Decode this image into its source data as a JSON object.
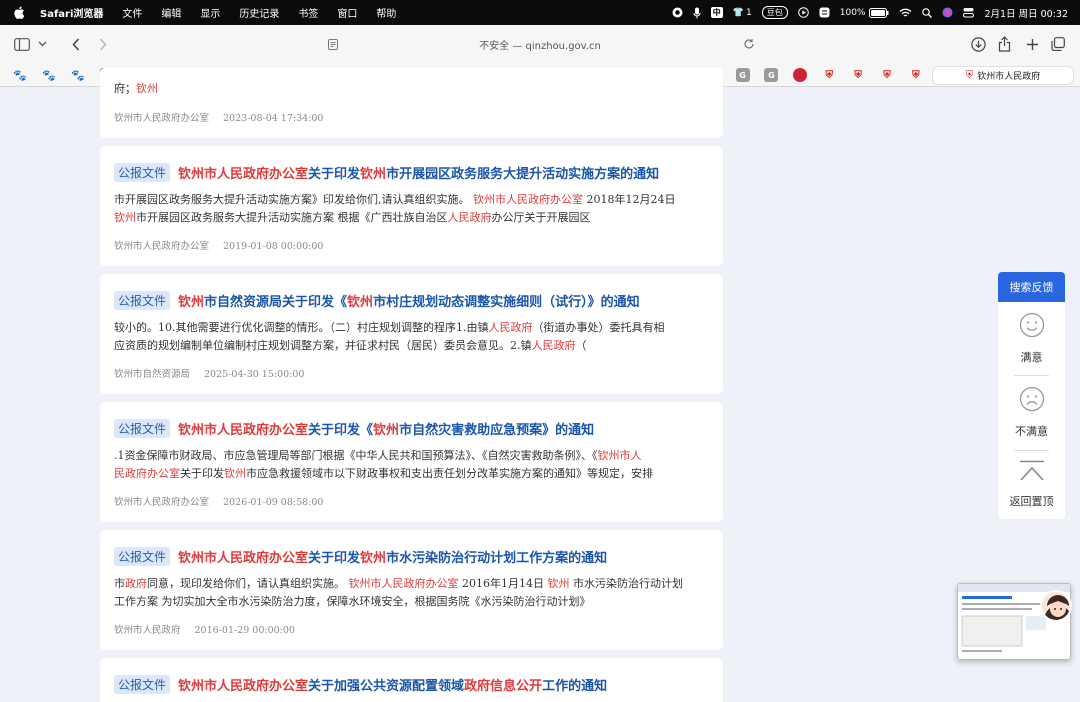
{
  "menubar": {
    "app": "Safari浏览器",
    "items": [
      "文件",
      "编辑",
      "显示",
      "历史记录",
      "书签",
      "窗口",
      "帮助"
    ],
    "tray": {
      "badge_count": "1",
      "douban": "豆包",
      "battery": "100%",
      "datetime": "2月1日 周日  00:32"
    }
  },
  "toolbar": {
    "address": "不安全 — qinzhou.gov.cn"
  },
  "favorites": {
    "icons": [
      "paw",
      "paw",
      "paw",
      "N",
      "N",
      "gov",
      "gov",
      "H",
      "H",
      "paw",
      "star",
      "paw",
      "H",
      "gov",
      "gov",
      "gov",
      "paw",
      "N",
      "gov",
      "gov",
      "star",
      "star",
      "S",
      "gov",
      "G",
      "G",
      "G",
      "round",
      "gov",
      "gov",
      "gov",
      "gov"
    ],
    "active_tab": "钦州市人民政府"
  },
  "results": [
    {
      "desc": [
        [
          [
            "府；",
            ""
          ],
          [
            "钦州",
            "red"
          ]
        ]
      ],
      "meta": [
        "钦州市人民政府办公室",
        "2023-08-04 17:34:00"
      ]
    },
    {
      "tag": "公报文件",
      "title": [
        [
          "钦州市人民政府办公室",
          "red"
        ],
        [
          "关于印发",
          ""
        ],
        [
          "钦州",
          "red"
        ],
        [
          "市开展园区政务服务大提升活动实施方案的通知",
          ""
        ]
      ],
      "desc": [
        [
          [
            "市开展园区政务服务大提升活动实施方案》印发给你们,请认真组织实施。 ",
            ""
          ],
          [
            "钦州市人民政府办公室",
            "red"
          ],
          [
            " 2018年12月24日",
            ""
          ]
        ],
        [
          [
            "钦州",
            "red"
          ],
          [
            "市开展园区政务服务大提升活动实施方案 根据《广西壮族自治区",
            ""
          ],
          [
            "人民政府",
            "red"
          ],
          [
            "办公厅关于开展园区",
            ""
          ]
        ]
      ],
      "meta": [
        "钦州市人民政府办公室",
        "2019-01-08 00:00:00"
      ]
    },
    {
      "tag": "公报文件",
      "title": [
        [
          "钦州",
          "red"
        ],
        [
          "市自然资源局关于印发《",
          ""
        ],
        [
          "钦州",
          "red"
        ],
        [
          "市村庄规划动态调整实施细则（试行）》的通知",
          ""
        ]
      ],
      "desc": [
        [
          [
            "较小的。10.其他需要进行优化调整的情形。（二）村庄规划调整的程序1.由镇",
            ""
          ],
          [
            "人民政府",
            "red"
          ],
          [
            "（街道办事处）委托具有相",
            ""
          ]
        ],
        [
          [
            "应资质的规划编制单位编制村庄规划调整方案，并征求村民（居民）委员会意见。2.镇",
            ""
          ],
          [
            "人民政府",
            "red"
          ],
          [
            "（",
            ""
          ]
        ]
      ],
      "meta": [
        "钦州市自然资源局",
        "2025-04-30 15:00:00"
      ]
    },
    {
      "tag": "公报文件",
      "title": [
        [
          "钦州市人民政府办公室",
          "red"
        ],
        [
          "关于印发《",
          ""
        ],
        [
          "钦州",
          "red"
        ],
        [
          "市自然灾害救助应急预案》的通知",
          ""
        ]
      ],
      "desc": [
        [
          [
            ".1资金保障市财政局、市应急管理局等部门根据《中华人民共和国预算法》、《自然灾害救助条例》、《",
            ""
          ],
          [
            "钦州市人",
            "red"
          ]
        ],
        [
          [
            "民政府办公室",
            "red"
          ],
          [
            "关于印发",
            ""
          ],
          [
            "钦州",
            "red"
          ],
          [
            "市应急救援领域市以下财政事权和支出责任划分改革实施方案的通知》等规定，安排",
            ""
          ]
        ]
      ],
      "meta": [
        "钦州市人民政府办公室",
        "2026-01-09 08:58:00"
      ]
    },
    {
      "tag": "公报文件",
      "title": [
        [
          "钦州市人民政府办公室",
          "red"
        ],
        [
          "关于印发",
          ""
        ],
        [
          "钦州",
          "red"
        ],
        [
          "市水污染防治行动计划工作方案的通知",
          ""
        ]
      ],
      "desc": [
        [
          [
            "市",
            ""
          ],
          [
            "政府",
            "red"
          ],
          [
            "同意，现印发给你们，请认真组织实施。 ",
            ""
          ],
          [
            "钦州市人民政府办公室",
            "red"
          ],
          [
            " 2016年1月14日 ",
            ""
          ],
          [
            "钦州",
            "red"
          ],
          [
            " 市水污染防治行动计划",
            ""
          ]
        ],
        [
          [
            "工作方案        为切实加大全市水污染防治力度，保障水环境安全，根据国务院《水污染防治行动计划》",
            ""
          ]
        ]
      ],
      "meta": [
        "钦州市人民政府",
        "2016-01-29 00:00:00"
      ]
    },
    {
      "tag": "公报文件",
      "title": [
        [
          "钦州市人民政府办公室",
          "red"
        ],
        [
          "关于加强公共资源配置领域",
          ""
        ],
        [
          "政府信息公开",
          "red"
        ],
        [
          "工作的通知",
          ""
        ]
      ],
      "desc": [],
      "meta": []
    }
  ],
  "feedback": {
    "header": "搜索反馈",
    "satisfied": "满意",
    "unsatisfied": "不满意",
    "top": "返回置顶"
  }
}
